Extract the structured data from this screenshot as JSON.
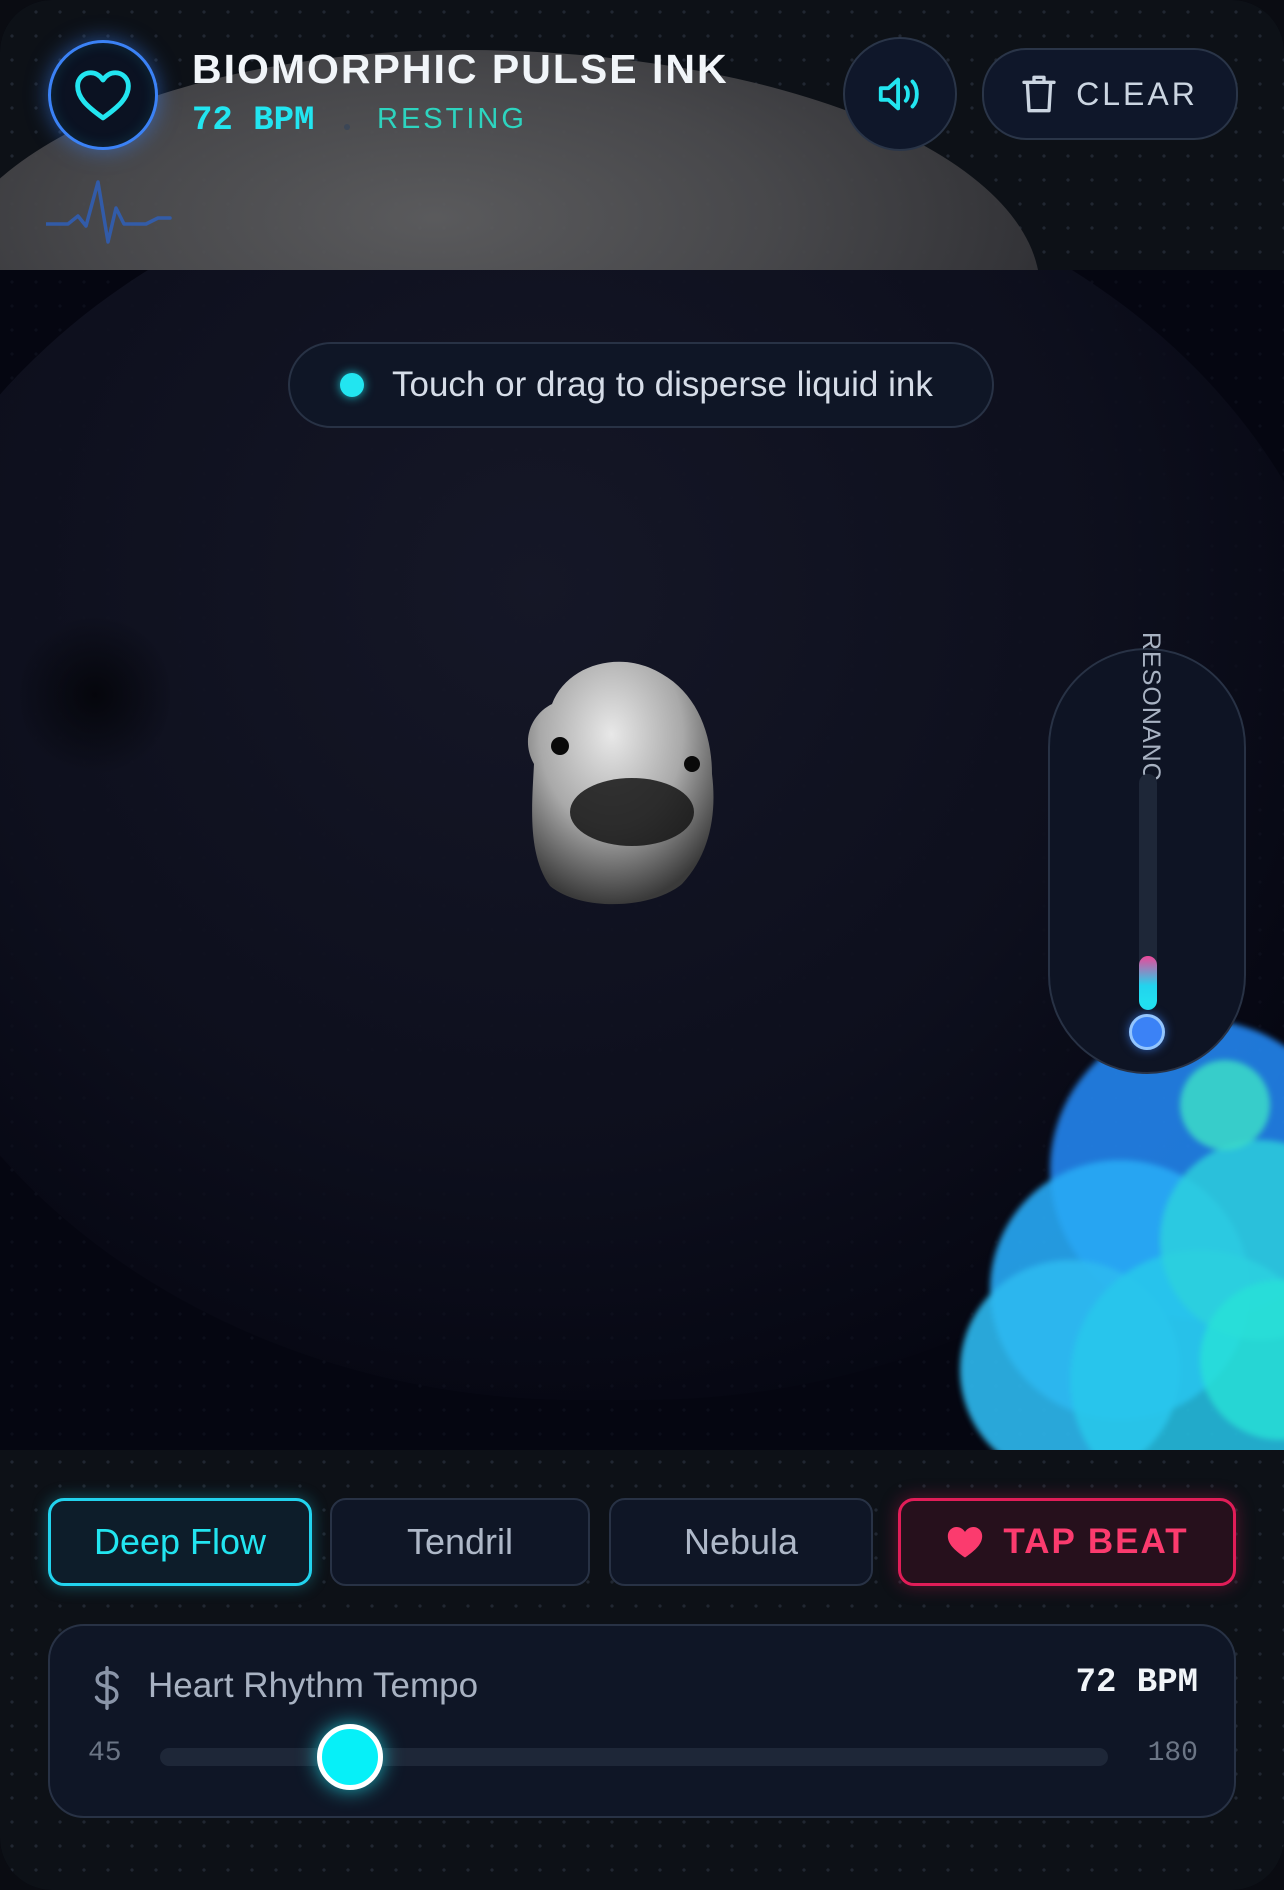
{
  "header": {
    "title": "BIOMORPHIC PULSE INK",
    "bpm": "72 BPM",
    "state": "RESTING",
    "clear_label": "CLEAR"
  },
  "icons": {
    "heart": "heart-icon",
    "sound": "speaker-icon",
    "clear": "trash-icon",
    "tempo": "dollar-icon",
    "tap": "heart-filled-icon",
    "pulse": "ecg-icon"
  },
  "canvas": {
    "hint": "Touch or drag to disperse liquid ink",
    "resonance_label": "RESONANC–",
    "resonance_level": 0.23
  },
  "modes": [
    {
      "label": "Deep Flow",
      "active": true
    },
    {
      "label": "Tendril",
      "active": false
    },
    {
      "label": "Nebula",
      "active": false
    }
  ],
  "tap_beat_label": "TAP BEAT",
  "tempo": {
    "label": "Heart Rhythm Tempo",
    "value_label": "72 BPM",
    "value": 72,
    "min": 45,
    "max": 180
  },
  "colors": {
    "accent_cyan": "#22e5f0",
    "accent_blue": "#3b82f6",
    "accent_pink": "#e11d58",
    "state_teal": "#2dd4bf"
  }
}
